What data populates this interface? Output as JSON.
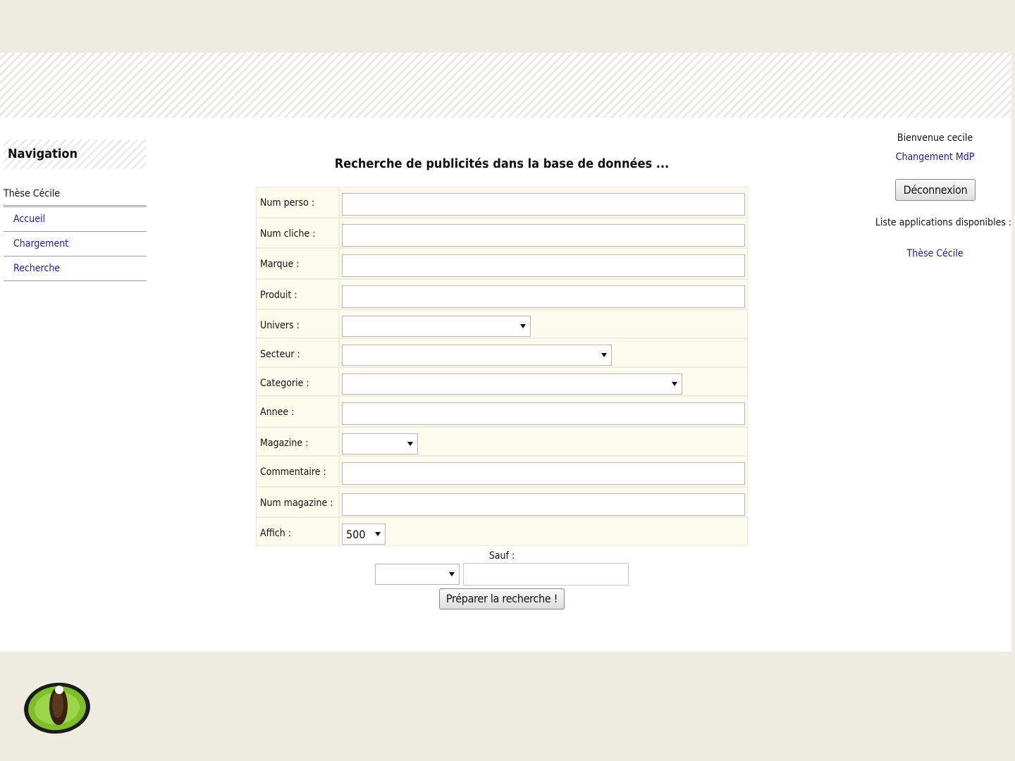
{
  "sidebar": {
    "title": "Navigation",
    "group": "Thèse Cécile",
    "items": [
      {
        "label": "Accueil"
      },
      {
        "label": "Chargement"
      },
      {
        "label": "Recherche"
      }
    ]
  },
  "form": {
    "title": "Recherche de publicités dans la base de données ...",
    "fields": {
      "num_perso": {
        "label": "Num perso :",
        "value": ""
      },
      "num_cliche": {
        "label": "Num cliche :",
        "value": ""
      },
      "marque": {
        "label": "Marque :",
        "value": ""
      },
      "produit": {
        "label": "Produit :",
        "value": ""
      },
      "univers": {
        "label": "Univers :",
        "value": ""
      },
      "secteur": {
        "label": "Secteur :",
        "value": ""
      },
      "categorie": {
        "label": "Categorie :",
        "value": ""
      },
      "annee": {
        "label": "Annee :",
        "value": ""
      },
      "magazine": {
        "label": "Magazine :",
        "value": ""
      },
      "commentaire": {
        "label": "Commentaire :",
        "value": ""
      },
      "num_magazine": {
        "label": "Num magazine :",
        "value": ""
      },
      "affich": {
        "label": "Affich :",
        "value": "500"
      }
    },
    "sauf": {
      "label": "Sauf :",
      "select_value": "",
      "input_value": ""
    },
    "submit_label": "Préparer la recherche !"
  },
  "user_panel": {
    "welcome": "Bienvenue cecile",
    "change_password": "Changement MdP",
    "logout_label": "Déconnexion",
    "apps_label": "Liste applications disponibles :",
    "apps": [
      {
        "label": "Thèse Cécile"
      }
    ]
  },
  "icons": {
    "logo": "green-eye-icon"
  },
  "colors": {
    "background": "#efece2",
    "link": "#1a1aa8",
    "form_bg": "#fdfbec",
    "eye_green": "#7fbf2a"
  }
}
